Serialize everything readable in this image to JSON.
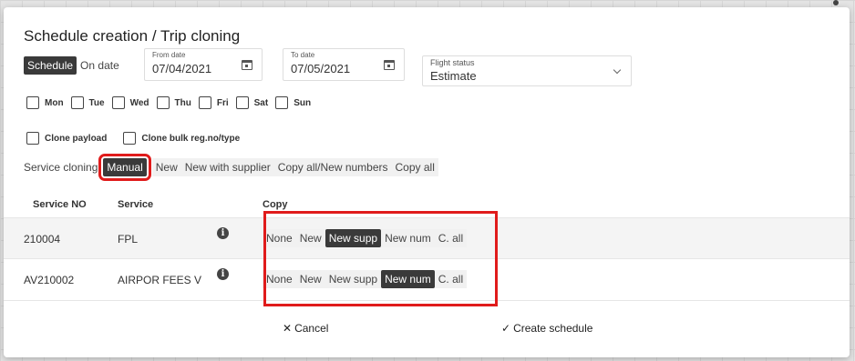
{
  "dialog": {
    "title": "Schedule creation / Trip cloning",
    "mode_toggle": {
      "options": [
        "Schedule",
        "On date"
      ],
      "selected": "Schedule"
    },
    "from_date": {
      "label": "From date",
      "value": "07/04/2021"
    },
    "to_date": {
      "label": "To date",
      "value": "07/05/2021"
    },
    "flight_status": {
      "label": "Flight status",
      "value": "Estimate"
    },
    "days": [
      "Mon",
      "Tue",
      "Wed",
      "Thu",
      "Fri",
      "Sat",
      "Sun"
    ],
    "options": [
      "Clone payload",
      "Clone bulk reg.no/type"
    ],
    "service_cloning": {
      "label": "Service cloning",
      "options": [
        "Manual",
        "New",
        "New with supplier",
        "Copy all/New numbers",
        "Copy all"
      ],
      "selected": "Manual"
    },
    "table": {
      "headers": {
        "service_no": "Service NO",
        "service": "Service",
        "copy": "Copy"
      },
      "copy_options": [
        "None",
        "New",
        "New supp",
        "New num",
        "C. all"
      ],
      "rows": [
        {
          "service_no": "210004",
          "service": "FPL",
          "copy_selected": "New supp"
        },
        {
          "service_no": "AV210002",
          "service": "AIRPOR FEES V",
          "copy_selected": "New num"
        }
      ]
    },
    "actions": {
      "cancel": "Cancel",
      "create": "Create schedule"
    }
  },
  "icons": {
    "calendar": "calendar-icon",
    "chevron": "chevron-down-icon",
    "info": "info-icon",
    "cancel": "close-icon",
    "create": "check-icon"
  },
  "colors": {
    "active_segment": "#3a3a3a",
    "highlight": "#e01b1b"
  }
}
